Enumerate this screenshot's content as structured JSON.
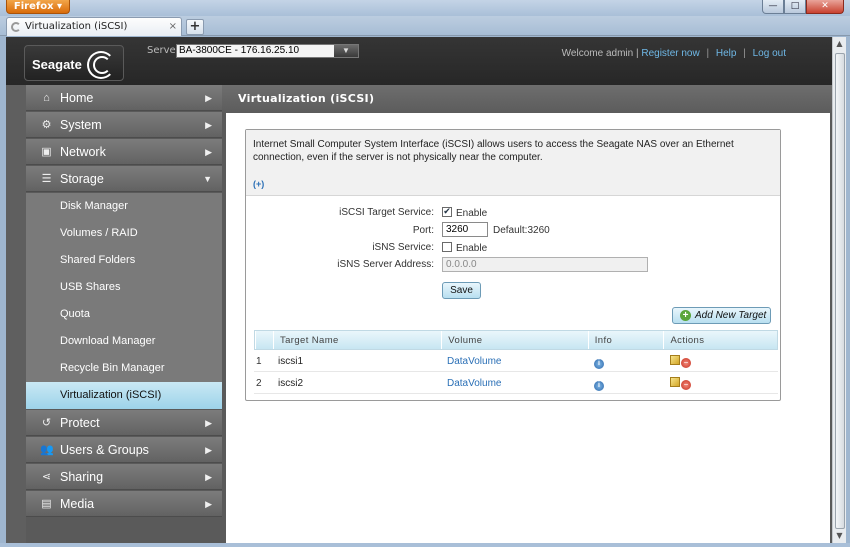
{
  "browser": {
    "menu_button": "Firefox ▾",
    "tab_title": "Virtualization (iSCSI)",
    "tab_close": "×",
    "new_tab": "+",
    "controls": {
      "minimize": "—",
      "maximize": "□",
      "close": "✕"
    }
  },
  "header": {
    "logo_text": "Seagate",
    "server_label": "Server:",
    "server_value": "BA-3800CE - 176.16.25.10",
    "welcome": "Welcome admin |",
    "register": "Register now",
    "help": "Help",
    "logout": "Log out"
  },
  "sidebar": {
    "items": [
      {
        "label": "Home",
        "icon": "home-icon",
        "glyph": "⌂",
        "chevron": "▶"
      },
      {
        "label": "System",
        "icon": "system-icon",
        "glyph": "⚙",
        "chevron": "▶"
      },
      {
        "label": "Network",
        "icon": "network-icon",
        "glyph": "▣",
        "chevron": "▶"
      },
      {
        "label": "Storage",
        "icon": "storage-icon",
        "glyph": "☰",
        "chevron": "▼"
      },
      {
        "label": "Protect",
        "icon": "protect-icon",
        "glyph": "↺",
        "chevron": "▶"
      },
      {
        "label": "Users & Groups",
        "icon": "users-icon",
        "glyph": "👥",
        "chevron": "▶"
      },
      {
        "label": "Sharing",
        "icon": "sharing-icon",
        "glyph": "⋖",
        "chevron": "▶"
      },
      {
        "label": "Media",
        "icon": "media-icon",
        "glyph": "▤",
        "chevron": "▶"
      }
    ],
    "storage_sub": [
      "Disk Manager",
      "Volumes / RAID",
      "Shared Folders",
      "USB Shares",
      "Quota",
      "Download Manager",
      "Recycle Bin Manager",
      "Virtualization (iSCSI)"
    ],
    "active_sub": "Virtualization (iSCSI)"
  },
  "main": {
    "title": "Virtualization (iSCSI)",
    "description": "Internet Small Computer System Interface (iSCSI) allows users to access the Seagate NAS over an Ethernet connection, even if the server is not physically near the computer.",
    "expand": "(+)",
    "form": {
      "target_service_label": "iSCSI Target Service:",
      "target_service_checked": true,
      "enable_label": "Enable",
      "port_label": "Port:",
      "port_value": "3260",
      "port_default": "Default:3260",
      "isns_service_label": "iSNS Service:",
      "isns_service_checked": false,
      "isns_address_label": "iSNS Server Address:",
      "isns_address_value": "0.0.0.0",
      "save": "Save"
    },
    "add_target": "Add New Target",
    "table": {
      "headers": [
        "",
        "Target Name",
        "Volume",
        "Info",
        "Actions"
      ],
      "rows": [
        {
          "num": "1",
          "name": "iscsi1",
          "volume": "DataVolume"
        },
        {
          "num": "2",
          "name": "iscsi2",
          "volume": "DataVolume"
        }
      ]
    }
  },
  "colors": {
    "accent_active": "#9dd3ea",
    "link": "#2a6fb6",
    "header_bg": "#2e2e2e",
    "firefox_orange": "#e07a10"
  }
}
